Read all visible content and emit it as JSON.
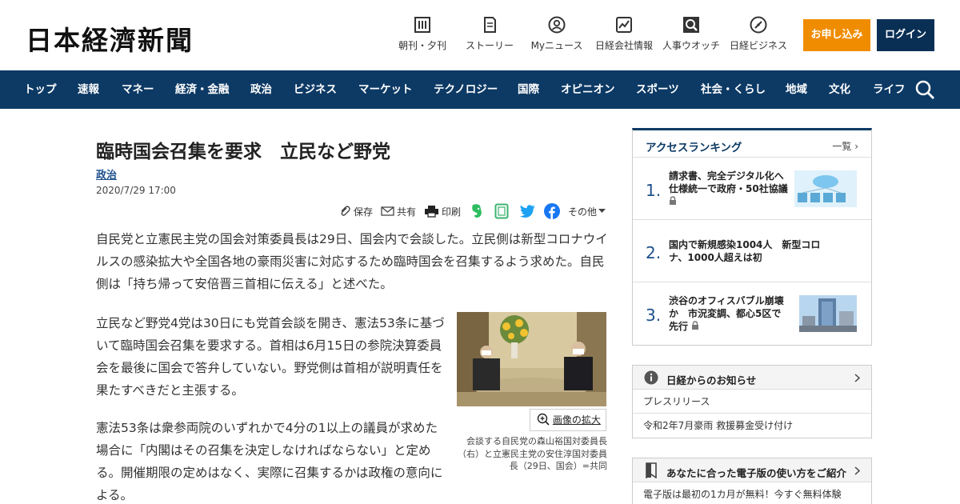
{
  "header": {
    "logo": "日本経濟新聞",
    "tools": [
      {
        "label": "朝刊・夕刊",
        "icon": "newspaper-icon"
      },
      {
        "label": "ストーリー",
        "icon": "book-icon"
      },
      {
        "label": "Myニュース",
        "icon": "user-icon"
      },
      {
        "label": "日経会社情報",
        "icon": "chart-icon"
      },
      {
        "label": "人事ウオッチ",
        "icon": "search-person-icon"
      },
      {
        "label": "日経ビジネス",
        "icon": "compass-icon"
      }
    ],
    "apply_label": "お申し込み",
    "login_label": "ログイン",
    "colors": {
      "apply": "#f08c00",
      "login": "#0a2f55",
      "nav": "#0d3a65"
    }
  },
  "nav": {
    "items": [
      "トップ",
      "速報",
      "マネー",
      "経済・金融",
      "政治",
      "ビジネス",
      "マーケット",
      "テクノロジー",
      "国際",
      "オピニオン",
      "スポーツ",
      "社会・くらし",
      "地域",
      "文化",
      "ライフ"
    ],
    "search_icon": "search-icon"
  },
  "article": {
    "title": "臨時国会召集を要求　立民など野党",
    "category": "政治",
    "date": "2020/7/29 17:00",
    "share": {
      "save": "保存",
      "share": "共有",
      "print": "印刷",
      "other": "その他"
    },
    "paragraphs": [
      "自民党と立憲民主党の国会対策委員長は29日、国会内で会談した。立民側は新型コロナウイルスの感染拡大や全国各地の豪雨災害に対応するため臨時国会を召集するよう求めた。自民側は「持ち帰って安倍晋三首相に伝える」と述べた。",
      "立民など野党4党は30日にも党首会談を開き、憲法53条に基づいて臨時国会召集を要求する。首相は6月15日の参院決算委員会を最後に国会で答弁していない。野党側は首相が説明責任を果たすべきだと主張する。",
      "憲法53条は衆参両院のいずれかで4分の1以上の議員が求めた場合に「内閣はその召集を決定しなければならない」と定める。開催期限の定めはなく、実際に召集するかは政権の意向による。"
    ],
    "photo_zoom_label": "画像の拡大",
    "photo_caption": "会談する自民党の森山裕国対委員長（右）と立憲民主党の安住淳国対委員長（29日、国会）=共同"
  },
  "sidebar": {
    "ranking": {
      "title": "アクセスランキング",
      "more": "一覧",
      "items": [
        {
          "rank": "1.",
          "text": "請求書、完全デジタル化へ　仕様統一で政府・50社協議",
          "locked": true
        },
        {
          "rank": "2.",
          "text": "国内で新規感染1004人　新型コロナ、1000人超えは初",
          "locked": false
        },
        {
          "rank": "3.",
          "text": "渋谷のオフィスバブル崩壊か　市況変調、都心5区で先行",
          "locked": true
        }
      ]
    },
    "notice": {
      "title": "日経からのお知らせ",
      "rows": [
        "プレスリリース",
        "令和2年7月豪雨 救援募金受け付け"
      ]
    },
    "guide": {
      "title": "あなたに合った電子版の使い方をご紹介",
      "rows": [
        "電子版は最初の1カ月が無料！今すぐ無料体験"
      ]
    }
  }
}
